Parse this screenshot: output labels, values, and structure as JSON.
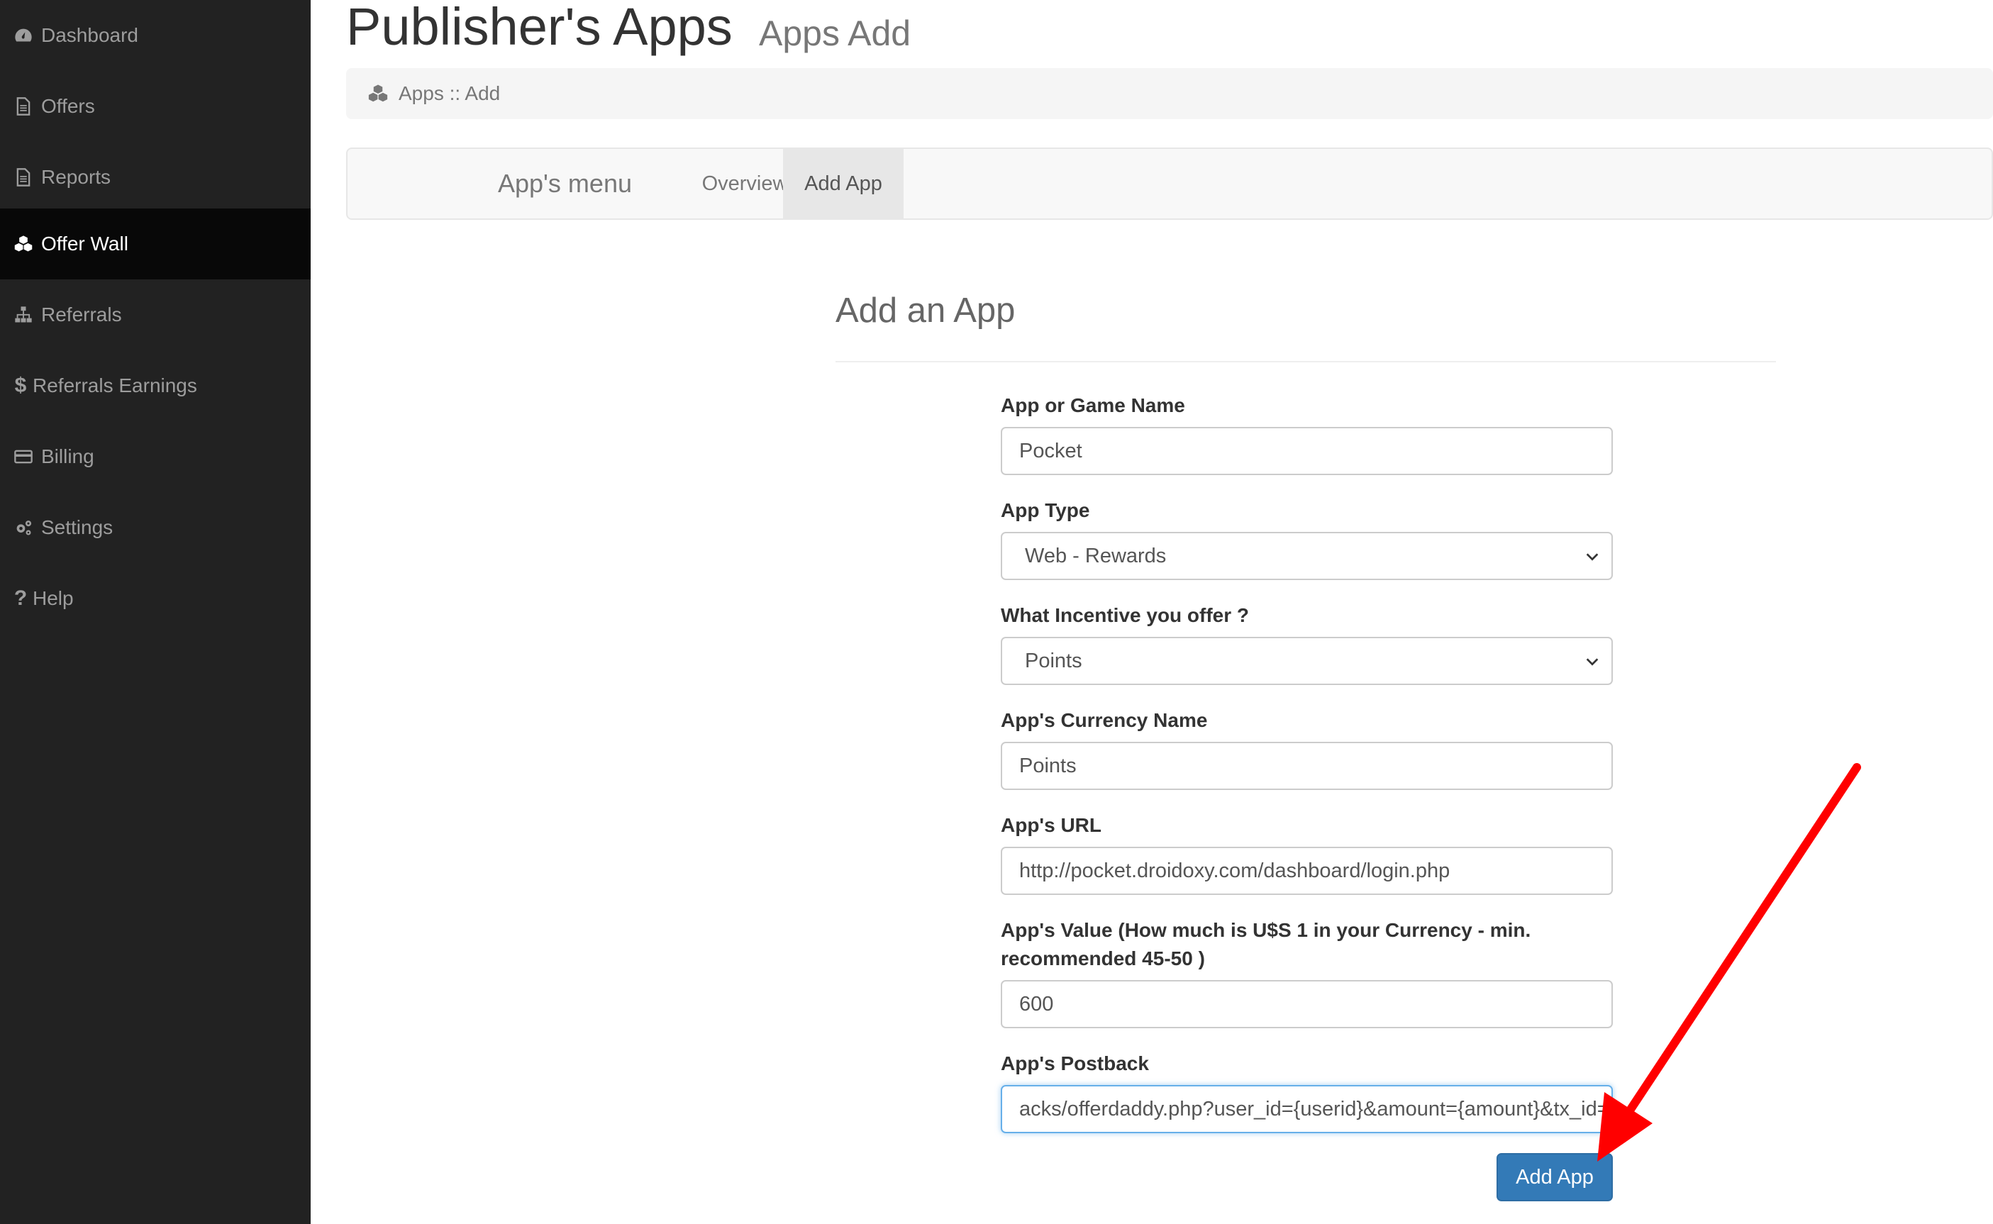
{
  "sidebar": {
    "items": [
      {
        "label": "Dashboard",
        "icon": "dashboard-icon",
        "active": false
      },
      {
        "label": "Offers",
        "icon": "document-icon",
        "active": false
      },
      {
        "label": "Reports",
        "icon": "document-icon",
        "active": false
      },
      {
        "label": "Offer Wall",
        "icon": "cubes-icon",
        "active": true
      },
      {
        "label": "Referrals",
        "icon": "sitemap-icon",
        "active": false
      },
      {
        "label": "Referrals Earnings",
        "icon": "dollar-icon",
        "active": false
      },
      {
        "label": "Billing",
        "icon": "credit-card-icon",
        "active": false
      },
      {
        "label": "Settings",
        "icon": "cogs-icon",
        "active": false
      },
      {
        "label": "Help",
        "icon": "question-icon",
        "active": false
      }
    ]
  },
  "header": {
    "title": "Publisher's Apps",
    "subtitle": "Apps Add"
  },
  "breadcrumb": {
    "icon": "cubes-icon",
    "text": "Apps :: Add"
  },
  "navbar": {
    "brand": "App's menu",
    "links": [
      {
        "label": "Overview",
        "active": false
      },
      {
        "label": "Add App",
        "active": true
      }
    ]
  },
  "form": {
    "title": "Add an App",
    "fields": {
      "name": {
        "label": "App or Game Name",
        "value": "Pocket"
      },
      "type": {
        "label": "App Type",
        "value": "Web - Rewards"
      },
      "incentive": {
        "label": "What Incentive you offer ?",
        "value": "Points"
      },
      "currency": {
        "label": "App's Currency Name",
        "value": "Points"
      },
      "url": {
        "label": "App's URL",
        "value": "http://pocket.droidoxy.com/dashboard/login.php"
      },
      "value": {
        "label": "App's Value (How much is U$S 1 in your Currency - min. recommended 45-50 )",
        "value": "600"
      },
      "postback": {
        "label": "App's Postback",
        "value": "acks/offerdaddy.php?user_id={userid}&amount={amount}&tx_id="
      }
    },
    "submit_label": "Add App"
  },
  "colors": {
    "sidebar_bg": "#222222",
    "sidebar_active_bg": "#080808",
    "primary": "#337ab7",
    "annotation_arrow": "#ff0000"
  }
}
